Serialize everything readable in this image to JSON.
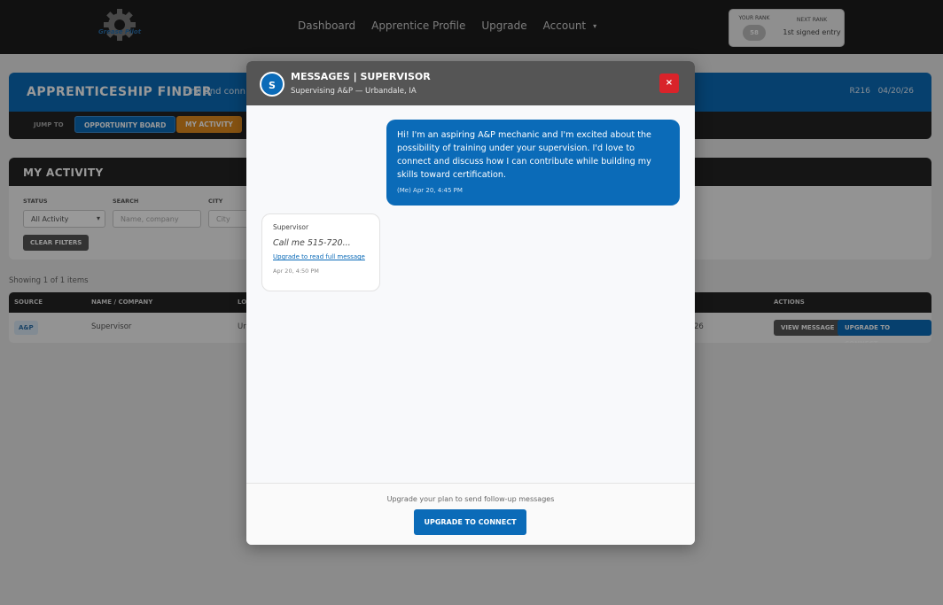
{
  "nav": {
    "logo_text": "Grease Pilot",
    "links": [
      "Dashboard",
      "Apprentice Profile",
      "Upgrade",
      "Account"
    ],
    "caret": "▾",
    "rank": {
      "your_rank_label": "YOUR RANK",
      "your_rank_value": "58",
      "next_rank_label": "NEXT RANK",
      "next_rank_value": "1st signed entry"
    }
  },
  "finder": {
    "title": "APPRENTICESHIP FINDER",
    "subtitle": "Find and conn",
    "meta_code": "R216",
    "meta_date": "04/20/26",
    "jump_label": "JUMP TO",
    "jump_buttons": [
      "OPPORTUNITY BOARD",
      "MY ACTIVITY"
    ]
  },
  "activity": {
    "title": "MY ACTIVITY",
    "filters": {
      "status_label": "STATUS",
      "status_value": "All Activity",
      "search_label": "SEARCH",
      "search_placeholder": "Name, company",
      "city_label": "CITY",
      "city_placeholder": "City"
    },
    "clear_label": "CLEAR FILTERS"
  },
  "showing": "Showing 1 of 1 items",
  "table": {
    "headers": [
      "SOURCE",
      "NAME / COMPANY",
      "LO",
      "ACTIONS"
    ],
    "row": {
      "source": "A&P",
      "name": "Supervisor",
      "location": "Ur",
      "date": "26",
      "view_label": "VIEW MESSAGE",
      "upgrade_label": "UPGRADE TO CONNECT"
    }
  },
  "modal": {
    "avatar_letter": "S",
    "title": "MESSAGES | SUPERVISOR",
    "subtitle": "Supervising A&P — Urbandale, IA",
    "close_label": "×",
    "my_message": {
      "text": "Hi! I'm an aspiring A&P mechanic and I'm excited about the possibility of training under your supervision. I'd love to connect and discuss how I can contribute while building my skills toward certification.",
      "time": "(Me) Apr 20, 4:45 PM"
    },
    "supervisor_message": {
      "sender": "Supervisor",
      "preview": "Call me 515-720...",
      "link": "Upgrade to read full message",
      "time": "Apr 20, 4:50 PM"
    },
    "footer_note": "Upgrade your plan to send follow-up messages",
    "footer_button": "UPGRADE TO CONNECT"
  },
  "colors": {
    "primary": "#0b6bb8",
    "accent_orange": "#e08a1e",
    "dark": "#232323",
    "close_red": "#d9232a"
  }
}
